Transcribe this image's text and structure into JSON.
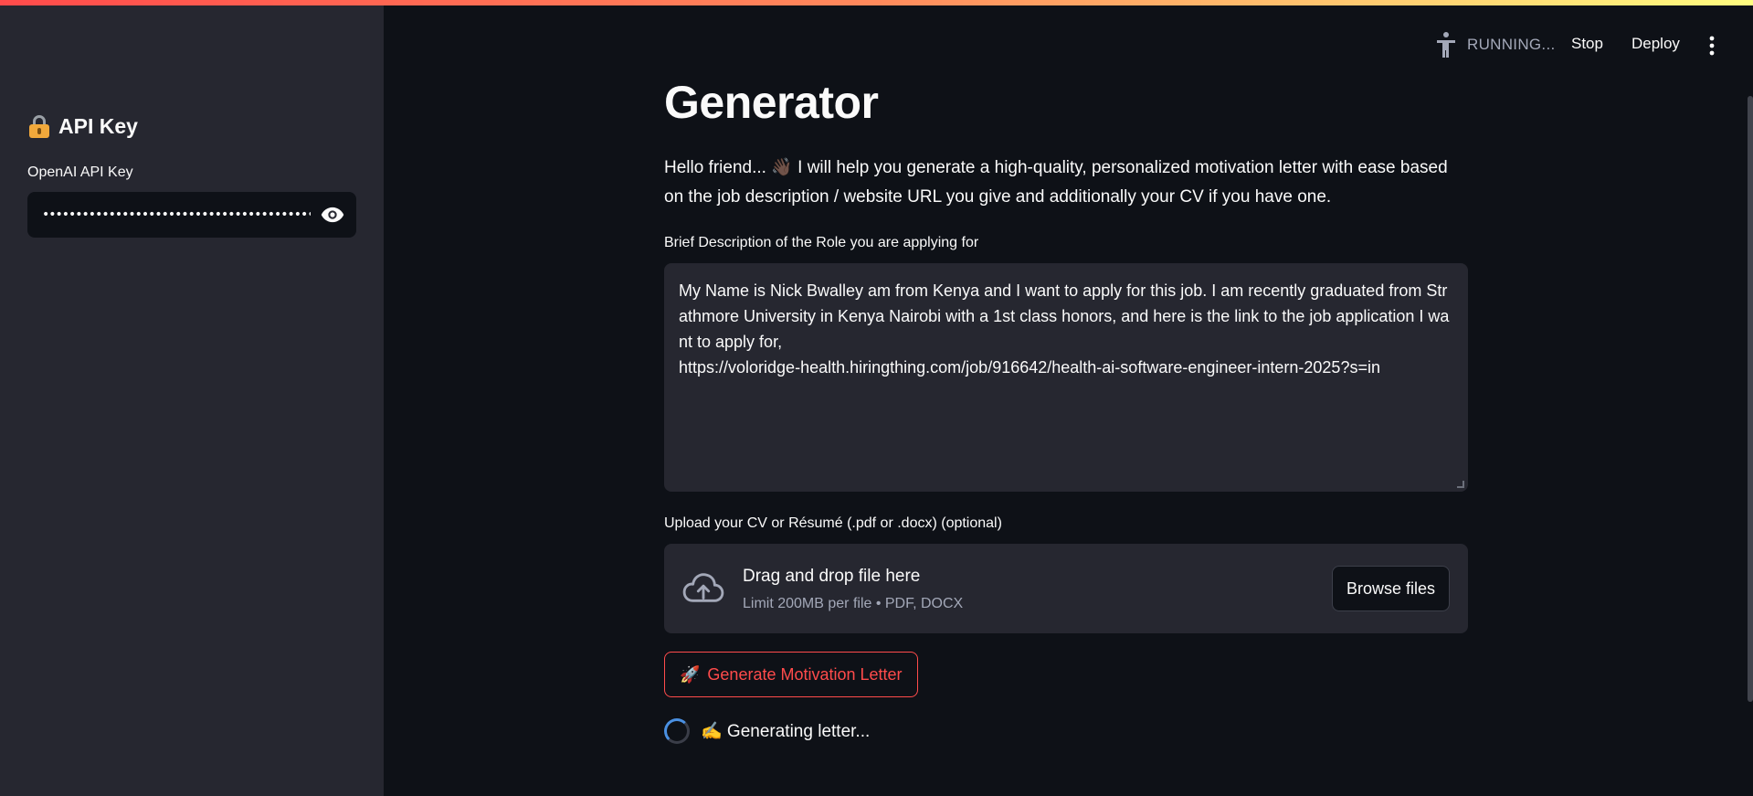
{
  "sidebar": {
    "heading": "API Key",
    "heading_icon": "lock-with-key-icon",
    "api_label": "OpenAI API Key",
    "api_value": "••••••••••••••••••••••••••••••••••••••••••••••••••••"
  },
  "header": {
    "status": "RUNNING...",
    "stop_label": "Stop",
    "deploy_label": "Deploy"
  },
  "main": {
    "title": "Generator",
    "intro": "Hello friend... 👋🏿 I will help you generate a high-quality, personalized motivation letter with ease based on the job description / website URL you give and additionally your CV if you have one.",
    "role_label": "Brief Description of the Role you are applying for",
    "role_text": "My Name is Nick Bwalley am from Kenya and I want to apply for this job. I am recently graduated from Strathmore University in Kenya Nairobi with a 1st class honors, and here is the link to the job application I want to apply for,\nhttps://voloridge-health.hiringthing.com/job/916642/health-ai-software-engineer-intern-2025?s=in",
    "upload_label": "Upload your CV or Résumé (.pdf or .docx) (optional)",
    "drop_title": "Drag and drop file here",
    "drop_sub": "Limit 200MB per file • PDF, DOCX",
    "browse_label": "Browse files",
    "generate_icon": "🚀",
    "generate_label": "Generate Motivation Letter",
    "status_text": "✍️ Generating letter..."
  },
  "colors": {
    "background": "#0e1117",
    "sidebar": "#262730",
    "accent": "#ff4b4b"
  }
}
